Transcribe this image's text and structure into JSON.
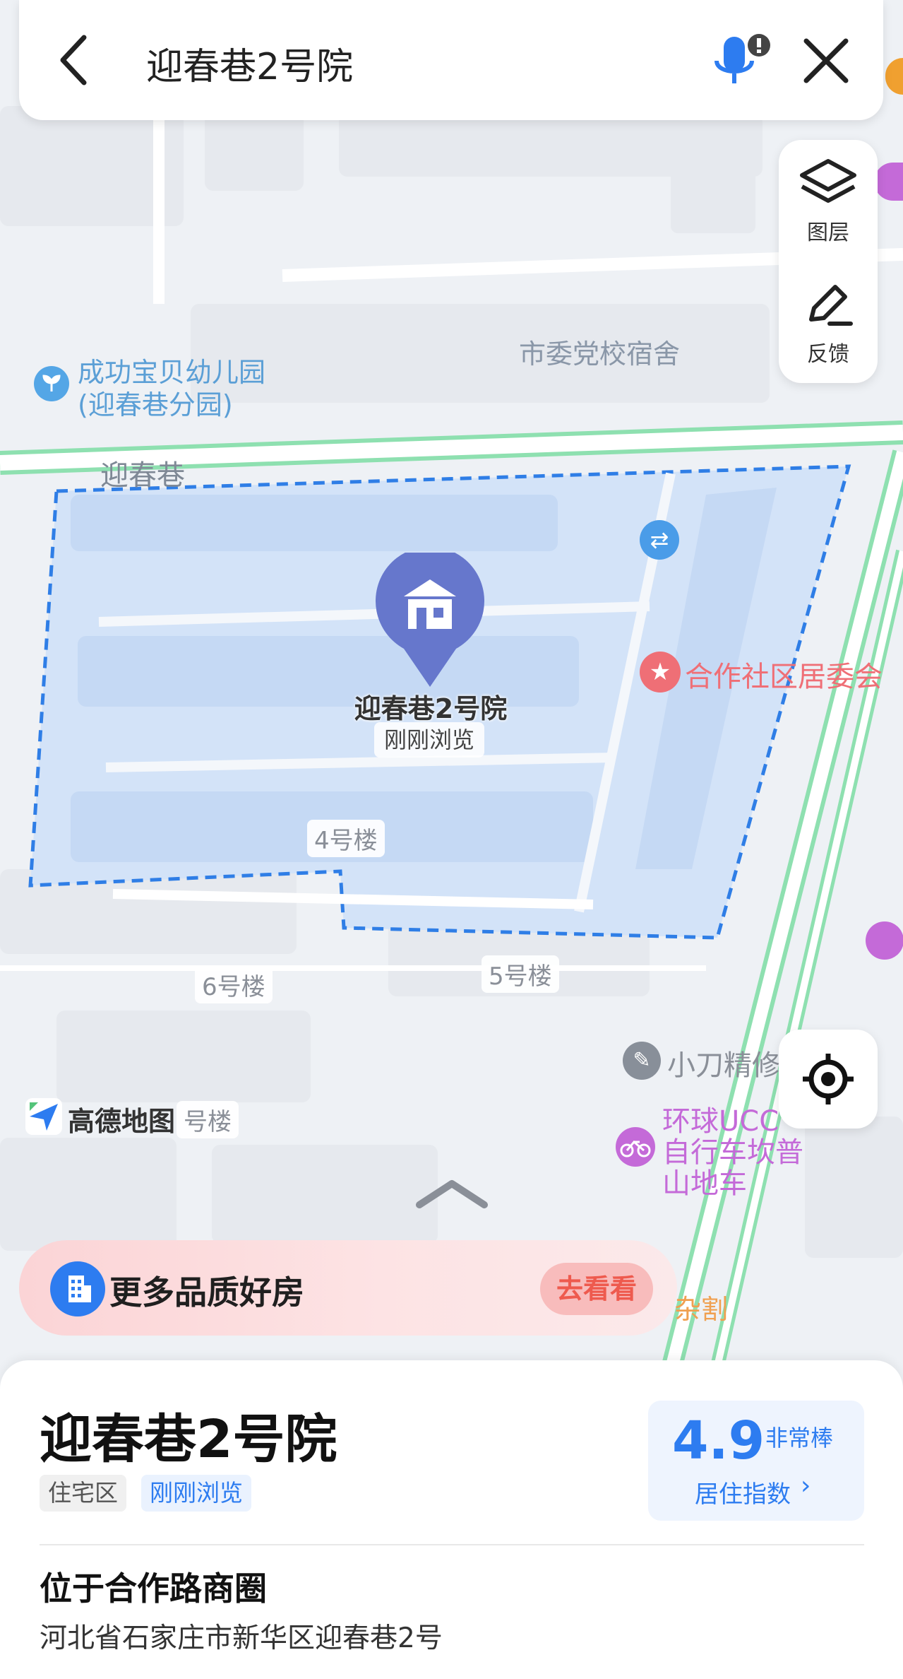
{
  "search": {
    "query": "迎春巷2号院"
  },
  "tools": {
    "layers_label": "图层",
    "feedback_label": "反馈"
  },
  "map": {
    "pois": {
      "kindergarten_line1": "成功宝贝幼儿园",
      "kindergarten_line2": "(迎春巷分园)",
      "party_school_dorm": "市委党校宿舍",
      "street_name": "迎春巷",
      "community_committee": "合作社区居委会",
      "repair_shop": "小刀精修",
      "bike_shop_line1": "环球UCC",
      "bike_shop_line2": "自行车坎普",
      "bike_shop_line3": "山地车",
      "misc_shop": "杂割"
    },
    "buildings": {
      "b4": "4号楼",
      "b5": "5号楼",
      "b6": "6号楼",
      "b_partial": "号楼"
    },
    "marker": {
      "title": "迎春巷2号院",
      "subtitle": "刚刚浏览"
    },
    "brand": "高德地图"
  },
  "promo": {
    "text": "更多品质好房",
    "button": "去看看"
  },
  "place": {
    "name": "迎春巷2号院",
    "tags": [
      "住宅区",
      "刚刚浏览"
    ],
    "score": "4.9",
    "score_desc": "非常棒",
    "score_label": "居住指数",
    "area": "位于合作路商圈",
    "address": "河北省石家庄市新华区迎春巷2号"
  },
  "colors": {
    "accent_blue": "#2d7cf0",
    "road_green": "#8ee0b0",
    "boundary_blue": "#2f7ee6",
    "marker_purple": "#6677cc",
    "promo_red": "#ee5a4e"
  }
}
